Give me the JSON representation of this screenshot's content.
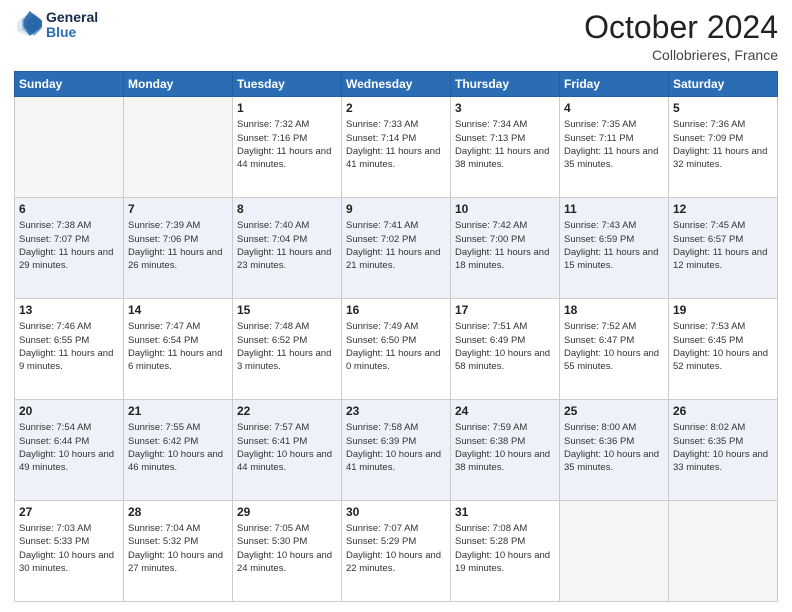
{
  "header": {
    "logo_line1": "General",
    "logo_line2": "Blue",
    "month": "October 2024",
    "location": "Collobrieres, France"
  },
  "weekdays": [
    "Sunday",
    "Monday",
    "Tuesday",
    "Wednesday",
    "Thursday",
    "Friday",
    "Saturday"
  ],
  "weeks": [
    [
      {
        "day": "",
        "info": ""
      },
      {
        "day": "",
        "info": ""
      },
      {
        "day": "1",
        "info": "Sunrise: 7:32 AM\nSunset: 7:16 PM\nDaylight: 11 hours and 44 minutes."
      },
      {
        "day": "2",
        "info": "Sunrise: 7:33 AM\nSunset: 7:14 PM\nDaylight: 11 hours and 41 minutes."
      },
      {
        "day": "3",
        "info": "Sunrise: 7:34 AM\nSunset: 7:13 PM\nDaylight: 11 hours and 38 minutes."
      },
      {
        "day": "4",
        "info": "Sunrise: 7:35 AM\nSunset: 7:11 PM\nDaylight: 11 hours and 35 minutes."
      },
      {
        "day": "5",
        "info": "Sunrise: 7:36 AM\nSunset: 7:09 PM\nDaylight: 11 hours and 32 minutes."
      }
    ],
    [
      {
        "day": "6",
        "info": "Sunrise: 7:38 AM\nSunset: 7:07 PM\nDaylight: 11 hours and 29 minutes."
      },
      {
        "day": "7",
        "info": "Sunrise: 7:39 AM\nSunset: 7:06 PM\nDaylight: 11 hours and 26 minutes."
      },
      {
        "day": "8",
        "info": "Sunrise: 7:40 AM\nSunset: 7:04 PM\nDaylight: 11 hours and 23 minutes."
      },
      {
        "day": "9",
        "info": "Sunrise: 7:41 AM\nSunset: 7:02 PM\nDaylight: 11 hours and 21 minutes."
      },
      {
        "day": "10",
        "info": "Sunrise: 7:42 AM\nSunset: 7:00 PM\nDaylight: 11 hours and 18 minutes."
      },
      {
        "day": "11",
        "info": "Sunrise: 7:43 AM\nSunset: 6:59 PM\nDaylight: 11 hours and 15 minutes."
      },
      {
        "day": "12",
        "info": "Sunrise: 7:45 AM\nSunset: 6:57 PM\nDaylight: 11 hours and 12 minutes."
      }
    ],
    [
      {
        "day": "13",
        "info": "Sunrise: 7:46 AM\nSunset: 6:55 PM\nDaylight: 11 hours and 9 minutes."
      },
      {
        "day": "14",
        "info": "Sunrise: 7:47 AM\nSunset: 6:54 PM\nDaylight: 11 hours and 6 minutes."
      },
      {
        "day": "15",
        "info": "Sunrise: 7:48 AM\nSunset: 6:52 PM\nDaylight: 11 hours and 3 minutes."
      },
      {
        "day": "16",
        "info": "Sunrise: 7:49 AM\nSunset: 6:50 PM\nDaylight: 11 hours and 0 minutes."
      },
      {
        "day": "17",
        "info": "Sunrise: 7:51 AM\nSunset: 6:49 PM\nDaylight: 10 hours and 58 minutes."
      },
      {
        "day": "18",
        "info": "Sunrise: 7:52 AM\nSunset: 6:47 PM\nDaylight: 10 hours and 55 minutes."
      },
      {
        "day": "19",
        "info": "Sunrise: 7:53 AM\nSunset: 6:45 PM\nDaylight: 10 hours and 52 minutes."
      }
    ],
    [
      {
        "day": "20",
        "info": "Sunrise: 7:54 AM\nSunset: 6:44 PM\nDaylight: 10 hours and 49 minutes."
      },
      {
        "day": "21",
        "info": "Sunrise: 7:55 AM\nSunset: 6:42 PM\nDaylight: 10 hours and 46 minutes."
      },
      {
        "day": "22",
        "info": "Sunrise: 7:57 AM\nSunset: 6:41 PM\nDaylight: 10 hours and 44 minutes."
      },
      {
        "day": "23",
        "info": "Sunrise: 7:58 AM\nSunset: 6:39 PM\nDaylight: 10 hours and 41 minutes."
      },
      {
        "day": "24",
        "info": "Sunrise: 7:59 AM\nSunset: 6:38 PM\nDaylight: 10 hours and 38 minutes."
      },
      {
        "day": "25",
        "info": "Sunrise: 8:00 AM\nSunset: 6:36 PM\nDaylight: 10 hours and 35 minutes."
      },
      {
        "day": "26",
        "info": "Sunrise: 8:02 AM\nSunset: 6:35 PM\nDaylight: 10 hours and 33 minutes."
      }
    ],
    [
      {
        "day": "27",
        "info": "Sunrise: 7:03 AM\nSunset: 5:33 PM\nDaylight: 10 hours and 30 minutes."
      },
      {
        "day": "28",
        "info": "Sunrise: 7:04 AM\nSunset: 5:32 PM\nDaylight: 10 hours and 27 minutes."
      },
      {
        "day": "29",
        "info": "Sunrise: 7:05 AM\nSunset: 5:30 PM\nDaylight: 10 hours and 24 minutes."
      },
      {
        "day": "30",
        "info": "Sunrise: 7:07 AM\nSunset: 5:29 PM\nDaylight: 10 hours and 22 minutes."
      },
      {
        "day": "31",
        "info": "Sunrise: 7:08 AM\nSunset: 5:28 PM\nDaylight: 10 hours and 19 minutes."
      },
      {
        "day": "",
        "info": ""
      },
      {
        "day": "",
        "info": ""
      }
    ]
  ]
}
